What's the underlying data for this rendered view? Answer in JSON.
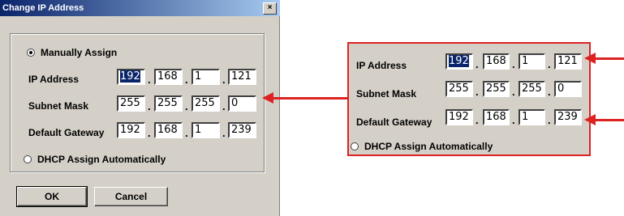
{
  "window": {
    "title": "Change IP Address",
    "close_glyph": "×"
  },
  "mode_options": {
    "manual": "Manually Assign",
    "dhcp": "DHCP Assign Automatically",
    "selected": "manual"
  },
  "fields": {
    "ip": {
      "label": "IP Address",
      "octets": [
        "192",
        "168",
        "1",
        "121"
      ]
    },
    "subnet": {
      "label": "Subnet Mask",
      "octets": [
        "255",
        "255",
        "255",
        "0"
      ]
    },
    "gateway": {
      "label": "Default Gateway",
      "octets": [
        "192",
        "168",
        "1",
        "239"
      ]
    }
  },
  "separator": ".",
  "buttons": {
    "ok": "OK",
    "cancel": "Cancel"
  },
  "colors": {
    "annotation": "#dd2222",
    "dialog_bg": "#d4d0c8",
    "titlebar": "#0a246a"
  }
}
